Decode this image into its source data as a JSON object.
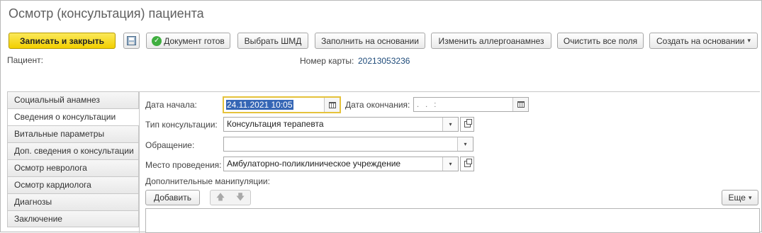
{
  "window": {
    "title": "Осмотр (консультация) пациента"
  },
  "toolbar": {
    "save_close": "Записать и закрыть",
    "save_icon": "floppy-save-icon",
    "doc_ready": "Документ готов",
    "doc_ready_icon": "green-check-icon",
    "choose_shmd": "Выбрать ШМД",
    "fill_based": "Заполнить на основании",
    "change_allergo": "Изменить аллергоанамнез",
    "clear_all": "Очистить все поля",
    "create_based": "Создать на основании",
    "create_based_arrow": "▾"
  },
  "header": {
    "patient_label": "Пациент:",
    "card_label": "Номер карты:",
    "card_number": "20213053236"
  },
  "tabs": [
    {
      "label": "Социальный анамнез",
      "active": false
    },
    {
      "label": "Сведения о консультации",
      "active": true
    },
    {
      "label": "Витальные параметры",
      "active": false
    },
    {
      "label": "Доп. сведения о консультации",
      "active": false
    },
    {
      "label": "Осмотр невролога",
      "active": false
    },
    {
      "label": "Осмотр кардиолога",
      "active": false
    },
    {
      "label": "Диагнозы",
      "active": false
    },
    {
      "label": "Заключение",
      "active": false
    }
  ],
  "form": {
    "start_date_label": "Дата начала:",
    "start_date_value": "24.11.2021 10:05",
    "end_date_label": "Дата окончания:",
    "end_date_mask": ". .    :",
    "consult_type_label": "Тип консультации:",
    "consult_type_value": "Консультация терапевта",
    "appeal_label": "Обращение:",
    "appeal_value": "",
    "place_label": "Место проведения:",
    "place_value": "Амбулаторно-поликлиническое учреждение",
    "extra_label": "Дополнительные манипуляции:",
    "add_button": "Добавить",
    "up_arrow": "🡅",
    "down_arrow": "🡇",
    "more_button": "Еще",
    "more_arrow": "▾",
    "dropdown_arrow": "▾"
  }
}
